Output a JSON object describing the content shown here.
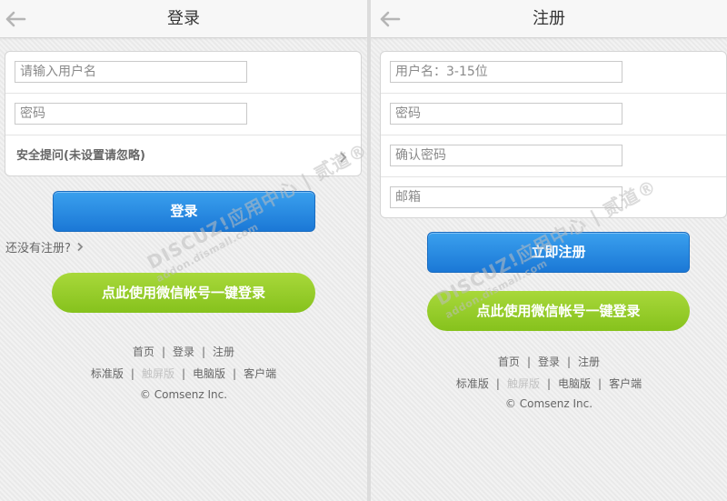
{
  "login": {
    "title": "登录",
    "username_placeholder": "请输入用户名",
    "password_placeholder": "密码",
    "security_question": "安全提问(未设置请忽略)",
    "login_button": "登录",
    "no_account_link": "还没有注册?",
    "wechat_button": "点此使用微信帐号一键登录"
  },
  "register": {
    "title": "注册",
    "username_placeholder": "用户名：3-15位",
    "password_placeholder": "密码",
    "confirm_placeholder": "确认密码",
    "email_placeholder": "邮箱",
    "register_button": "立即注册",
    "wechat_button": "点此使用微信帐号一键登录"
  },
  "footer": {
    "home": "首页",
    "login": "登录",
    "register": "注册",
    "standard": "标准版",
    "touch": "触屏版",
    "desktop": "电脑版",
    "client": "客户端",
    "separator": "|",
    "copyright": "© Comsenz Inc."
  },
  "watermark": {
    "brand": "DISCUZ!应用中心 | 贰道®",
    "domain": "addon.dismall.com"
  },
  "icons": {
    "back": "back-arrow-icon",
    "chevron": "chevron-right-icon"
  },
  "colors": {
    "blue_button": "#1f80dc",
    "green_button": "#8cc625",
    "muted_link": "#c2c2c2"
  }
}
